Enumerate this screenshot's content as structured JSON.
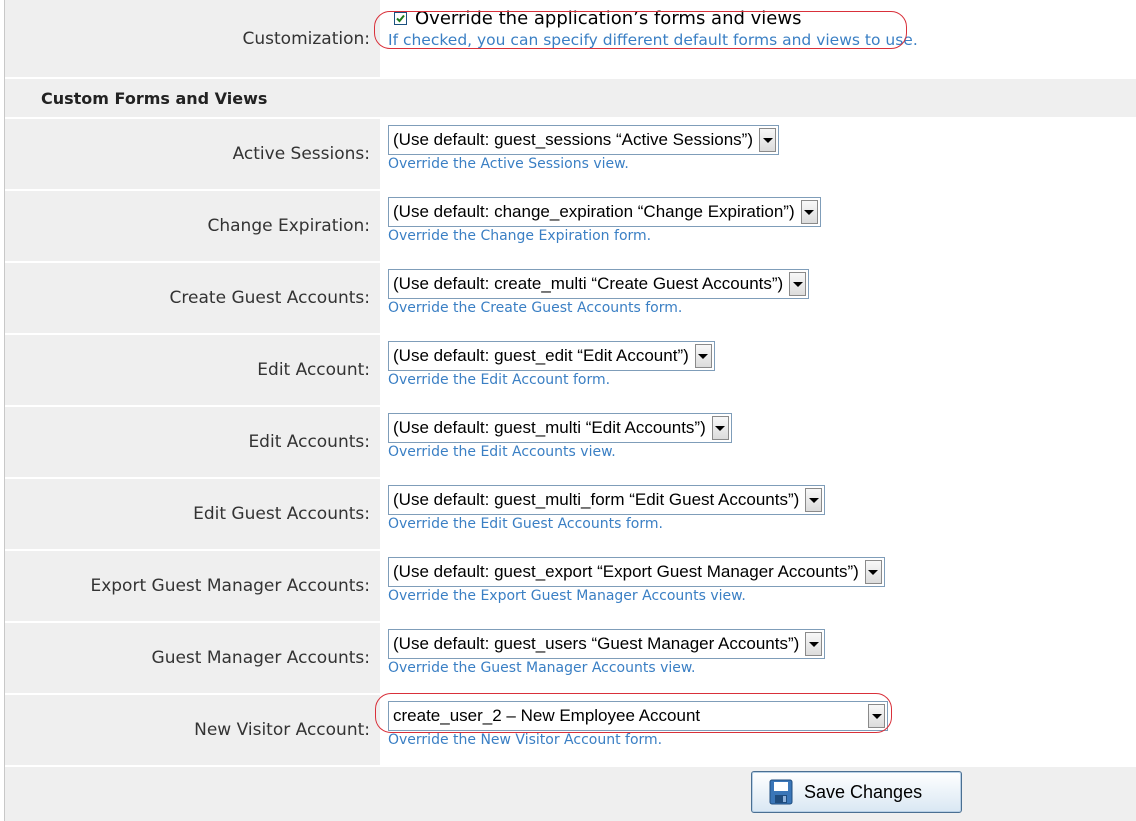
{
  "customization": {
    "label": "Customization:",
    "checkbox_checked": true,
    "checkbox_label": "Override the application’s forms and views",
    "hint": "If checked, you can specify different default forms and views to use."
  },
  "section_title": "Custom Forms and Views",
  "rows": [
    {
      "label": "Active Sessions:",
      "value": "(Use default: guest_sessions “Active Sessions”)",
      "hint": "Override the Active Sessions view."
    },
    {
      "label": "Change Expiration:",
      "value": "(Use default: change_expiration “Change Expiration”)",
      "hint": "Override the Change Expiration form."
    },
    {
      "label": "Create Guest Accounts:",
      "value": "(Use default: create_multi “Create Guest Accounts”)",
      "hint": "Override the Create Guest Accounts form."
    },
    {
      "label": "Edit Account:",
      "value": "(Use default: guest_edit “Edit Account”)",
      "hint": "Override the Edit Account form."
    },
    {
      "label": "Edit Accounts:",
      "value": "(Use default: guest_multi “Edit Accounts”)",
      "hint": "Override the Edit Accounts view."
    },
    {
      "label": "Edit Guest Accounts:",
      "value": "(Use default: guest_multi_form “Edit Guest Accounts”)",
      "hint": "Override the Edit Guest Accounts form."
    },
    {
      "label": "Export Guest Manager Accounts:",
      "value": "(Use default: guest_export “Export Guest Manager Accounts”)",
      "hint": "Override the Export Guest Manager Accounts view."
    },
    {
      "label": "Guest Manager Accounts:",
      "value": "(Use default: guest_users “Guest Manager Accounts”)",
      "hint": "Override the Guest Manager Accounts view."
    },
    {
      "label": "New Visitor Account:",
      "value": "create_user_2 – New Employee Account",
      "hint": "Override the New Visitor Account form."
    }
  ],
  "save_button": {
    "label": "Save Changes",
    "icon": "floppy-disk-icon"
  },
  "colors": {
    "hint": "#3a7fc4",
    "highlight": "#d9303a",
    "label_bg": "#efefef"
  }
}
